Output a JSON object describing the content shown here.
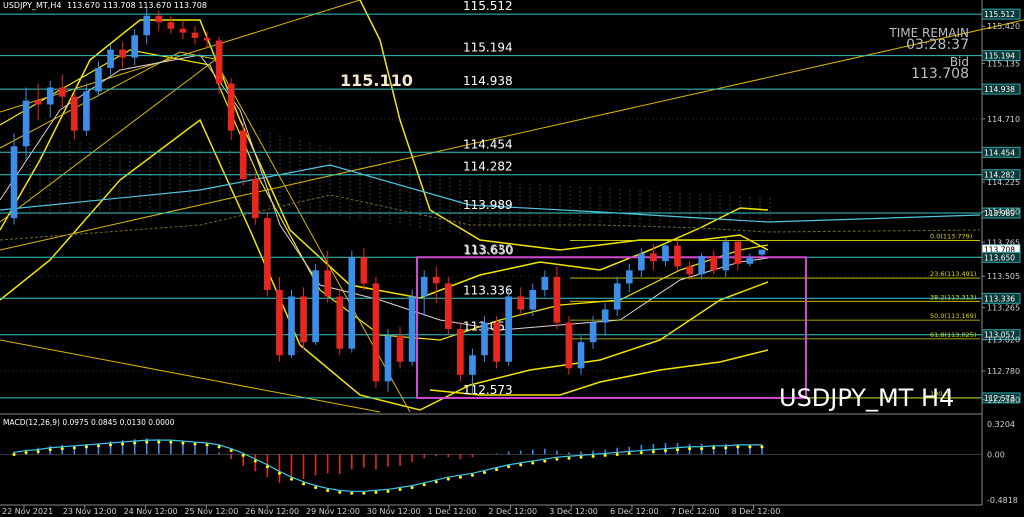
{
  "header": {
    "symbol_tf": "USDJPY_MT,H4",
    "ohlc": "113.670 113.708 113.670 113.708",
    "time_remain_label": "TIME REMAIN",
    "time_remain_value": "03:28:37",
    "bid_label": "Bid",
    "bid_value": "113.708",
    "big_level": "115.110",
    "watermark": "USDJPY_MT H4"
  },
  "macd": {
    "label": "MACD(12,26,9) 0.0975 0.0845 0.0130 0.0000",
    "scale": [
      "0.3204",
      "0.00",
      "-0.4818"
    ]
  },
  "colors": {
    "bull": "#3d8ee8",
    "bear": "#e8281e",
    "band": "#f2e600",
    "level": "#33c7c7",
    "box": "#d24ad2",
    "cloud": "#8c8c8c",
    "grid": "#2a2a2a"
  },
  "chart_data": {
    "type": "candlestick",
    "symbol": "USDJPY_MT",
    "timeframe": "H4",
    "ylim": [
      112.45,
      115.62
    ],
    "y_ticks": [
      "115.420",
      "115.135",
      "114.710",
      "114.225",
      "114.000",
      "113.765",
      "113.505",
      "113.265",
      "113.020",
      "112.780",
      "112.560"
    ],
    "x_labels": [
      "22 Nov 2021",
      "23 Nov 12:00",
      "24 Nov 12:00",
      "25 Nov 12:00",
      "26 Nov 12:00",
      "29 Nov 12:00",
      "30 Nov 12:00",
      "1 Dec 12:00",
      "2 Dec 12:00",
      "3 Dec 12:00",
      "6 Dec 12:00",
      "7 Dec 12:00",
      "8 Dec 12:00"
    ],
    "levels": [
      {
        "label": "115.512",
        "value": 115.512
      },
      {
        "label": "115.194",
        "value": 115.194
      },
      {
        "label": "114.938",
        "value": 114.938
      },
      {
        "label": "114.454",
        "value": 114.454
      },
      {
        "label": "114.282",
        "value": 114.282
      },
      {
        "label": "113.989",
        "value": 113.989
      },
      {
        "label": "113.650",
        "value": 113.65
      },
      {
        "label": "113.336",
        "value": 113.336
      },
      {
        "label": "113.057",
        "value": 113.057
      },
      {
        "label": "112.573",
        "value": 112.573
      }
    ],
    "overlap_labels": [
      "113.630",
      "113.650"
    ],
    "price_tags": [
      {
        "label": "115.512",
        "value": 115.512
      },
      {
        "label": "115.194",
        "value": 115.194
      },
      {
        "label": "114.938",
        "value": 114.938
      },
      {
        "label": "114.454",
        "value": 114.454
      },
      {
        "label": "114.282",
        "value": 114.282
      },
      {
        "label": "113.989",
        "value": 113.989
      },
      {
        "label": "113.708",
        "value": 113.708
      },
      {
        "label": "113.650",
        "value": 113.65
      },
      {
        "label": "113.336",
        "value": 113.336
      },
      {
        "label": "113.057",
        "value": 113.057
      },
      {
        "label": "112.573",
        "value": 112.573
      }
    ],
    "fibo": [
      {
        "label": "0.0(113.779)",
        "value": 113.779
      },
      {
        "label": "23.6(113.491)",
        "value": 113.491
      },
      {
        "label": "38.2(113.313)",
        "value": 113.313
      },
      {
        "label": "50.0(113.169)",
        "value": 113.169
      },
      {
        "label": "61.8(113.025)",
        "value": 113.025
      },
      {
        "label": "100.0",
        "value": 112.573
      }
    ],
    "candles": [
      [
        113.95,
        114.6,
        113.9,
        114.5
      ],
      [
        114.5,
        114.95,
        114.4,
        114.85
      ],
      [
        114.85,
        114.98,
        114.7,
        114.82
      ],
      [
        114.82,
        115.0,
        114.72,
        114.95
      ],
      [
        114.95,
        115.05,
        114.8,
        114.88
      ],
      [
        114.88,
        114.92,
        114.55,
        114.62
      ],
      [
        114.62,
        114.98,
        114.58,
        114.92
      ],
      [
        114.92,
        115.15,
        114.88,
        115.1
      ],
      [
        115.1,
        115.28,
        115.05,
        115.24
      ],
      [
        115.24,
        115.3,
        115.1,
        115.18
      ],
      [
        115.18,
        115.4,
        115.12,
        115.35
      ],
      [
        115.35,
        115.56,
        115.28,
        115.5
      ],
      [
        115.5,
        115.54,
        115.38,
        115.45
      ],
      [
        115.45,
        115.5,
        115.36,
        115.4
      ],
      [
        115.4,
        115.46,
        115.32,
        115.37
      ],
      [
        115.37,
        115.42,
        115.28,
        115.33
      ],
      [
        115.33,
        115.38,
        115.25,
        115.31
      ],
      [
        115.31,
        115.34,
        114.9,
        114.98
      ],
      [
        114.98,
        115.02,
        114.55,
        114.62
      ],
      [
        114.62,
        114.68,
        114.2,
        114.25
      ],
      [
        114.25,
        114.3,
        113.9,
        113.95
      ],
      [
        113.95,
        114.0,
        113.35,
        113.4
      ],
      [
        113.4,
        113.5,
        112.85,
        112.9
      ],
      [
        112.9,
        113.4,
        112.88,
        113.35
      ],
      [
        113.35,
        113.42,
        112.95,
        113.0
      ],
      [
        113.0,
        113.6,
        112.98,
        113.55
      ],
      [
        113.55,
        113.7,
        113.3,
        113.35
      ],
      [
        113.35,
        113.4,
        112.9,
        112.95
      ],
      [
        112.95,
        113.7,
        112.92,
        113.65
      ],
      [
        113.65,
        113.72,
        113.4,
        113.45
      ],
      [
        113.45,
        113.5,
        112.65,
        112.7
      ],
      [
        112.7,
        113.1,
        112.62,
        113.05
      ],
      [
        113.05,
        113.12,
        112.8,
        112.85
      ],
      [
        112.85,
        113.4,
        112.82,
        113.35
      ],
      [
        113.35,
        113.55,
        113.2,
        113.5
      ],
      [
        113.5,
        113.58,
        113.3,
        113.45
      ],
      [
        113.45,
        113.5,
        113.05,
        113.1
      ],
      [
        113.1,
        113.15,
        112.7,
        112.75
      ],
      [
        112.75,
        112.95,
        112.6,
        112.9
      ],
      [
        112.9,
        113.2,
        112.85,
        113.15
      ],
      [
        113.15,
        113.2,
        112.8,
        112.85
      ],
      [
        112.85,
        113.4,
        112.82,
        113.35
      ],
      [
        113.35,
        113.42,
        113.2,
        113.25
      ],
      [
        113.25,
        113.45,
        113.2,
        113.4
      ],
      [
        113.4,
        113.55,
        113.35,
        113.5
      ],
      [
        113.5,
        113.58,
        113.1,
        113.15
      ],
      [
        113.15,
        113.2,
        112.75,
        112.8
      ],
      [
        112.8,
        113.05,
        112.75,
        113.0
      ],
      [
        113.0,
        113.2,
        112.95,
        113.15
      ],
      [
        113.15,
        113.3,
        113.05,
        113.25
      ],
      [
        113.25,
        113.5,
        113.2,
        113.45
      ],
      [
        113.45,
        113.6,
        113.38,
        113.55
      ],
      [
        113.55,
        113.72,
        113.5,
        113.68
      ],
      [
        113.68,
        113.75,
        113.55,
        113.62
      ],
      [
        113.62,
        113.76,
        113.58,
        113.74
      ],
      [
        113.74,
        113.78,
        113.55,
        113.58
      ],
      [
        113.58,
        113.62,
        113.48,
        113.52
      ],
      [
        113.52,
        113.68,
        113.48,
        113.66
      ],
      [
        113.66,
        113.7,
        113.52,
        113.55
      ],
      [
        113.55,
        113.8,
        113.5,
        113.77
      ],
      [
        113.77,
        113.78,
        113.55,
        113.6
      ],
      [
        113.6,
        113.68,
        113.58,
        113.65
      ],
      [
        113.67,
        113.71,
        113.66,
        113.708
      ]
    ],
    "macd_hist": [
      0.03,
      0.05,
      0.07,
      0.09,
      0.1,
      0.09,
      0.1,
      0.12,
      0.14,
      0.15,
      0.16,
      0.17,
      0.16,
      0.14,
      0.12,
      0.1,
      0.08,
      0.02,
      -0.05,
      -0.12,
      -0.18,
      -0.24,
      -0.3,
      -0.28,
      -0.26,
      -0.22,
      -0.2,
      -0.21,
      -0.16,
      -0.14,
      -0.16,
      -0.13,
      -0.12,
      -0.08,
      -0.04,
      -0.02,
      -0.03,
      -0.05,
      -0.03,
      0.0,
      0.01,
      0.03,
      0.04,
      0.05,
      0.06,
      0.04,
      0.02,
      0.03,
      0.04,
      0.05,
      0.07,
      0.08,
      0.1,
      0.11,
      0.12,
      0.12,
      0.11,
      0.11,
      0.1,
      0.11,
      0.1,
      0.1,
      0.1
    ],
    "macd_signal": [
      0.02,
      0.04,
      0.05,
      0.07,
      0.08,
      0.09,
      0.1,
      0.11,
      0.12,
      0.13,
      0.14,
      0.15,
      0.15,
      0.15,
      0.14,
      0.13,
      0.12,
      0.1,
      0.06,
      0.01,
      -0.05,
      -0.11,
      -0.18,
      -0.24,
      -0.29,
      -0.33,
      -0.36,
      -0.38,
      -0.39,
      -0.39,
      -0.38,
      -0.37,
      -0.35,
      -0.33,
      -0.3,
      -0.27,
      -0.24,
      -0.22,
      -0.2,
      -0.17,
      -0.14,
      -0.11,
      -0.09,
      -0.07,
      -0.05,
      -0.03,
      -0.02,
      -0.01,
      0.0,
      0.01,
      0.02,
      0.03,
      0.04,
      0.05,
      0.06,
      0.07,
      0.08,
      0.08,
      0.09,
      0.09,
      0.1,
      0.1,
      0.1
    ]
  }
}
